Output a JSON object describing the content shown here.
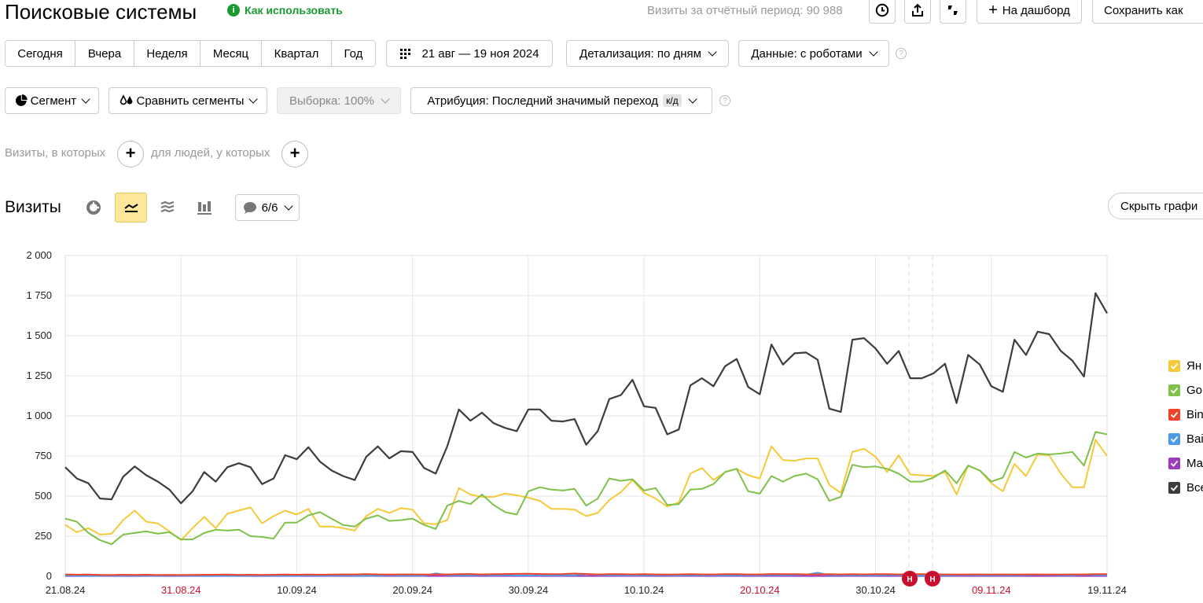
{
  "header": {
    "title": "Поисковые системы",
    "help_link": "Как использовать",
    "visits_label": "Визиты за отчётный период:",
    "visits_value": "90 988",
    "dashboard_button": "На дашборд",
    "save_as_button": "Сохранить как"
  },
  "periods": [
    "Сегодня",
    "Вчера",
    "Неделя",
    "Месяц",
    "Квартал",
    "Год"
  ],
  "date_range": "21 авг — 19 ноя 2024",
  "detail": "Детализация: по дням",
  "data_mode": "Данные: с роботами",
  "segment_button": "Сегмент",
  "compare_segments_button": "Сравнить сегменты",
  "sample": "Выборка: 100%",
  "attribution": "Атрибуция: Последний значимый переход",
  "attribution_badge": "к/д",
  "filters": {
    "visits_label": "Визиты, в которых",
    "people_label": "для людей, у которых"
  },
  "chart_header": {
    "title": "Визиты",
    "annotations": "6/6",
    "hide_button": "Скрыть графи"
  },
  "colors": {
    "yandex": "#f5c93a",
    "google": "#7fc14a",
    "bing": "#f0442a",
    "baidu": "#4b9be8",
    "mail": "#9b3bbd",
    "total": "#3d3d3d",
    "holiday": "#c8102e"
  },
  "chart_data": {
    "type": "line",
    "yticks": [
      "0",
      "250",
      "500",
      "750",
      "1 000",
      "1 250",
      "1 500",
      "1 750",
      "2 000"
    ],
    "ylim": [
      0,
      2000
    ],
    "x_start": "2024-08-21",
    "x_end": "2024-11-19",
    "xticks": [
      {
        "label": "21.08.24",
        "holiday": false
      },
      {
        "label": "31.08.24",
        "holiday": true
      },
      {
        "label": "10.09.24",
        "holiday": false
      },
      {
        "label": "20.09.24",
        "holiday": false
      },
      {
        "label": "30.09.24",
        "holiday": false
      },
      {
        "label": "10.10.24",
        "holiday": false
      },
      {
        "label": "20.10.24",
        "holiday": true
      },
      {
        "label": "30.10.24",
        "holiday": false
      },
      {
        "label": "09.11.24",
        "holiday": true
      },
      {
        "label": "19.11.24",
        "holiday": false
      }
    ],
    "event_markers": [
      "Н",
      "Н"
    ],
    "series": [
      {
        "name": "Ян",
        "key": "yandex",
        "values": [
          320,
          275,
          300,
          260,
          265,
          350,
          410,
          340,
          330,
          280,
          225,
          300,
          370,
          300,
          390,
          410,
          430,
          330,
          375,
          410,
          385,
          420,
          310,
          310,
          300,
          285,
          375,
          420,
          395,
          425,
          415,
          330,
          325,
          350,
          550,
          510,
          495,
          495,
          515,
          505,
          490,
          470,
          420,
          420,
          415,
          375,
          395,
          475,
          525,
          600,
          520,
          485,
          435,
          460,
          640,
          675,
          600,
          650,
          670,
          630,
          610,
          810,
          725,
          720,
          735,
          735,
          570,
          520,
          775,
          795,
          745,
          650,
          755,
          635,
          630,
          625,
          650,
          510,
          690,
          660,
          580,
          530,
          700,
          625,
          760,
          755,
          640,
          555,
          555,
          850,
          750
        ]
      },
      {
        "name": "Go",
        "key": "google",
        "values": [
          360,
          340,
          270,
          225,
          200,
          260,
          270,
          280,
          265,
          275,
          230,
          230,
          270,
          290,
          285,
          290,
          250,
          245,
          235,
          335,
          335,
          380,
          400,
          360,
          320,
          310,
          360,
          380,
          345,
          350,
          360,
          320,
          295,
          440,
          470,
          450,
          510,
          445,
          400,
          385,
          530,
          555,
          540,
          535,
          545,
          440,
          485,
          610,
          595,
          605,
          535,
          550,
          445,
          450,
          540,
          545,
          575,
          650,
          670,
          530,
          515,
          625,
          590,
          625,
          640,
          605,
          470,
          495,
          695,
          680,
          685,
          670,
          640,
          590,
          590,
          615,
          660,
          580,
          690,
          660,
          590,
          615,
          775,
          740,
          765,
          760,
          765,
          775,
          690,
          900,
          885
        ]
      },
      {
        "name": "Bin",
        "key": "bing",
        "values": [
          12,
          10,
          11,
          9,
          8,
          10,
          9,
          10,
          8,
          9,
          8,
          9,
          10,
          10,
          11,
          9,
          10,
          9,
          10,
          11,
          10,
          11,
          10,
          11,
          12,
          12,
          13,
          12,
          11,
          12,
          12,
          11,
          12,
          12,
          13,
          14,
          12,
          13,
          14,
          15,
          16,
          14,
          13,
          14,
          17,
          14,
          12,
          13,
          13,
          12,
          13,
          12,
          11,
          12,
          13,
          12,
          12,
          13,
          13,
          12,
          12,
          14,
          13,
          13,
          12,
          12,
          13,
          12,
          13,
          12,
          13,
          13,
          12,
          13,
          13,
          12,
          12,
          11,
          12,
          12,
          11,
          12,
          11,
          12,
          12,
          11,
          11,
          12,
          12,
          13,
          13
        ]
      },
      {
        "name": "Bai",
        "key": "baidu",
        "values": [
          5,
          4,
          3,
          3,
          4,
          4,
          5,
          3,
          3,
          4,
          4,
          3,
          4,
          3,
          4,
          3,
          3,
          4,
          4,
          3,
          3,
          5,
          4,
          4,
          5,
          3,
          4,
          4,
          6,
          4,
          5,
          4,
          18,
          7,
          6,
          5,
          8,
          6,
          6,
          5,
          5,
          6,
          5,
          7,
          6,
          14,
          8,
          7,
          6,
          5,
          6,
          7,
          6,
          5,
          7,
          6,
          6,
          5,
          7,
          6,
          6,
          8,
          7,
          9,
          10,
          22,
          8,
          7,
          6,
          7,
          6,
          8,
          7,
          6,
          5,
          5,
          7,
          6,
          8,
          6,
          6,
          7,
          6,
          8,
          10,
          8,
          7,
          6,
          10,
          8,
          7
        ]
      },
      {
        "name": "Ма",
        "key": "mail",
        "values": [
          2,
          2,
          2,
          2,
          2,
          2,
          2,
          2,
          2,
          2,
          2,
          2,
          2,
          2,
          2,
          2,
          2,
          2,
          2,
          2,
          2,
          2,
          2,
          2,
          2,
          2,
          2,
          2,
          2,
          2,
          2,
          2,
          2,
          2,
          2,
          2,
          2,
          2,
          2,
          2,
          2,
          2,
          2,
          2,
          2,
          2,
          2,
          2,
          2,
          2,
          2,
          2,
          2,
          2,
          2,
          2,
          2,
          2,
          2,
          2,
          2,
          2,
          2,
          2,
          2,
          2,
          2,
          2,
          2,
          2,
          2,
          2,
          2,
          2,
          2,
          2,
          2,
          2,
          2,
          2,
          2,
          2,
          2,
          2,
          2,
          2,
          2,
          2,
          2,
          2,
          2
        ]
      },
      {
        "name": "Все",
        "key": "total",
        "values": [
          680,
          610,
          580,
          485,
          480,
          620,
          685,
          630,
          590,
          540,
          455,
          530,
          650,
          590,
          680,
          705,
          680,
          575,
          610,
          755,
          730,
          805,
          715,
          660,
          625,
          600,
          745,
          810,
          735,
          780,
          775,
          675,
          640,
          810,
          1040,
          970,
          1020,
          955,
          925,
          905,
          1040,
          1040,
          970,
          965,
          980,
          820,
          905,
          1105,
          1130,
          1225,
          1060,
          1050,
          885,
          915,
          1190,
          1235,
          1185,
          1310,
          1355,
          1180,
          1135,
          1445,
          1320,
          1390,
          1395,
          1350,
          1045,
          1025,
          1475,
          1485,
          1420,
          1325,
          1405,
          1235,
          1235,
          1265,
          1325,
          1080,
          1380,
          1320,
          1185,
          1150,
          1475,
          1380,
          1525,
          1510,
          1405,
          1345,
          1245,
          1765,
          1640
        ]
      }
    ]
  }
}
